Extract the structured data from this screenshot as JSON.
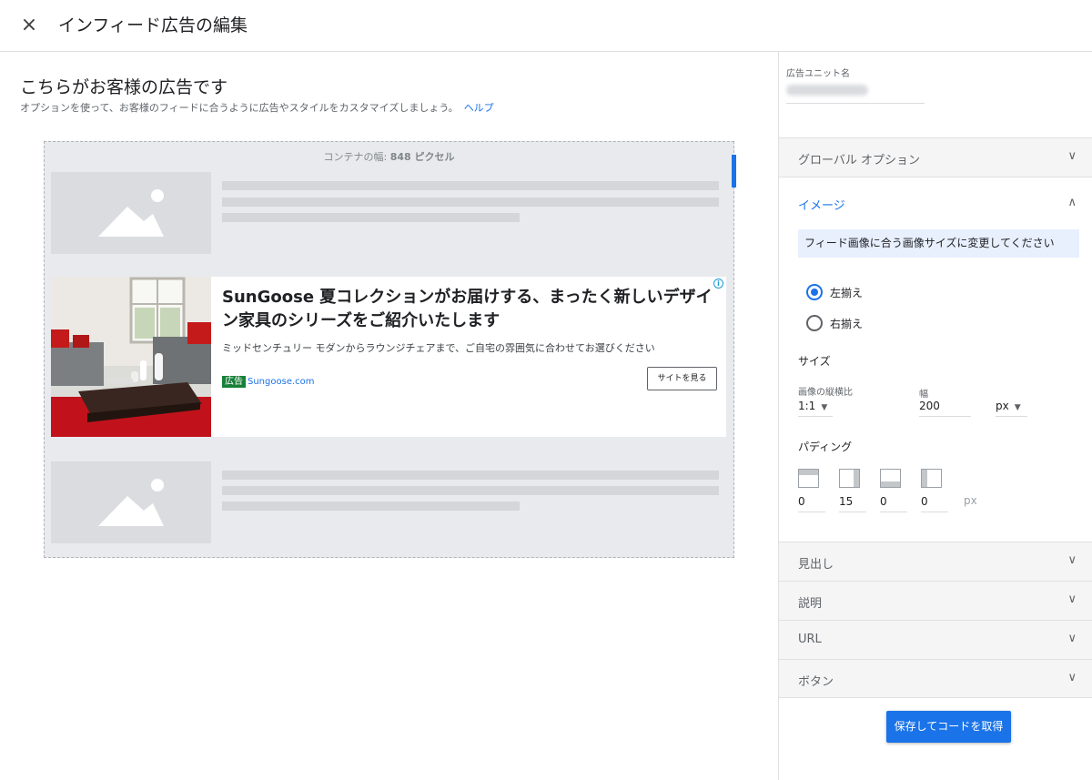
{
  "header": {
    "close_icon": "×",
    "title": "インフィード広告の編集"
  },
  "main": {
    "heading": "こちらがお客様の広告です",
    "description": "オプションを使って、お客様のフィードに合うように広告やスタイルをカスタマイズしましょう。",
    "help_link": "ヘルプ"
  },
  "preview": {
    "container_label": "コンテナの幅:",
    "container_value": "848 ピクセル",
    "ad": {
      "headline": "SunGoose 夏コレクションがお届けする、まったく新しいデザイン家具のシリーズをご紹介いたします",
      "description": "ミッドセンチュリー モダンからラウンジチェアまで、ご自宅の雰囲気に合わせてお選びください",
      "badge": "広告",
      "domain": "Sungoose.com",
      "cta": "サイトを見る",
      "choices_icon": "i"
    }
  },
  "sidebar": {
    "unit_name_label": "広告ユニット名",
    "sections": {
      "global": "グローバル オプション",
      "image": "イメージ",
      "headline": "見出し",
      "description": "説明",
      "url": "URL",
      "button": "ボタン"
    },
    "chevron_down": "∨",
    "chevron_up": "∧",
    "image": {
      "info": "フィード画像に合う画像サイズに変更してください",
      "align_left": "左揃え",
      "align_right": "右揃え",
      "selected_alignment": "left",
      "size_title": "サイズ",
      "aspect_label": "画像の縦横比",
      "aspect_value": "1:1",
      "width_label": "幅",
      "width_value": "200",
      "unit_value": "px",
      "padding_title": "パディング",
      "padding_values": [
        "0",
        "15",
        "0",
        "0"
      ],
      "padding_unit": "px"
    },
    "save_button": "保存してコードを取得"
  },
  "colors": {
    "accent": "#1a73e8",
    "ad_badge": "#188038"
  }
}
